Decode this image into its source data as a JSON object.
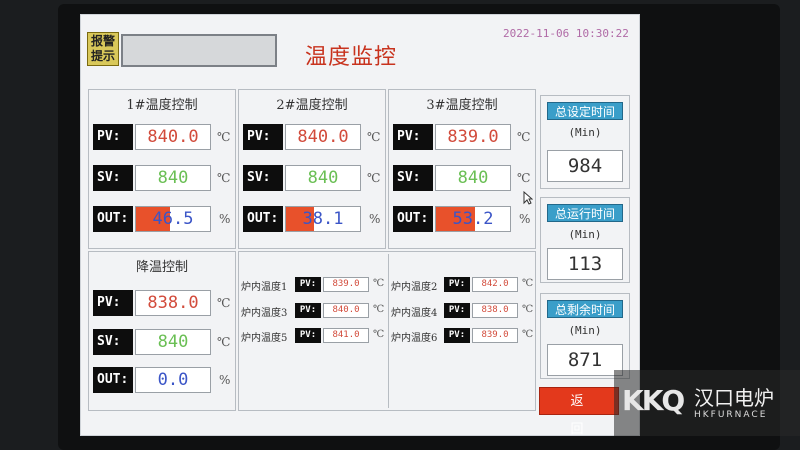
{
  "header": {
    "alarm_tag": "报警\n提示",
    "alarm_line1": "报警",
    "alarm_line2": "提示",
    "title": "温度监控",
    "datetime": "2022-11-06 10:30:22"
  },
  "zones": [
    {
      "title": "1#温度控制",
      "pv_label": "PV:",
      "pv": "840.0",
      "sv_label": "SV:",
      "sv": "840",
      "out_label": "OUT:",
      "out": "46.5",
      "out_percent": 46.5,
      "temp_unit": "℃",
      "out_unit": "%"
    },
    {
      "title": "2#温度控制",
      "pv_label": "PV:",
      "pv": "840.0",
      "sv_label": "SV:",
      "sv": "840",
      "out_label": "OUT:",
      "out": "38.1",
      "out_percent": 38.1,
      "temp_unit": "℃",
      "out_unit": "%"
    },
    {
      "title": "3#温度控制",
      "pv_label": "PV:",
      "pv": "839.0",
      "sv_label": "SV:",
      "sv": "840",
      "out_label": "OUT:",
      "out": "53.2",
      "out_percent": 53.2,
      "temp_unit": "℃",
      "out_unit": "%"
    },
    {
      "title": "降温控制",
      "pv_label": "PV:",
      "pv": "838.0",
      "sv_label": "SV:",
      "sv": "840",
      "out_label": "OUT:",
      "out": "0.0",
      "out_percent": 0,
      "temp_unit": "℃",
      "out_unit": "%"
    }
  ],
  "furnace_temps": [
    {
      "name": "炉内温度1",
      "label": "PV:",
      "value": "839.0",
      "unit": "℃"
    },
    {
      "name": "炉内温度2",
      "label": "PV:",
      "value": "842.0",
      "unit": "℃"
    },
    {
      "name": "炉内温度3",
      "label": "PV:",
      "value": "840.0",
      "unit": "℃"
    },
    {
      "name": "炉内温度4",
      "label": "PV:",
      "value": "838.0",
      "unit": "℃"
    },
    {
      "name": "炉内温度5",
      "label": "PV:",
      "value": "841.0",
      "unit": "℃"
    },
    {
      "name": "炉内温度6",
      "label": "PV:",
      "value": "839.0",
      "unit": "℃"
    }
  ],
  "times": [
    {
      "title": "总设定时间",
      "unit": "(Min)",
      "value": "984"
    },
    {
      "title": "总运行时间",
      "unit": "(Min)",
      "value": "113"
    },
    {
      "title": "总剩余时间",
      "unit": "(Min)",
      "value": "871"
    }
  ],
  "back_button": "返 回",
  "watermark": {
    "logo": "KKQ",
    "name": "汉口电炉",
    "sub": "HKFURNACE"
  },
  "colors": {
    "pv": "#d24b3b",
    "sv": "#6abf54",
    "out": "#3b55c7",
    "bar": "#e8512b",
    "time_header": "#3a9ec9",
    "back_button": "#e3391c",
    "title": "#c8331e"
  }
}
